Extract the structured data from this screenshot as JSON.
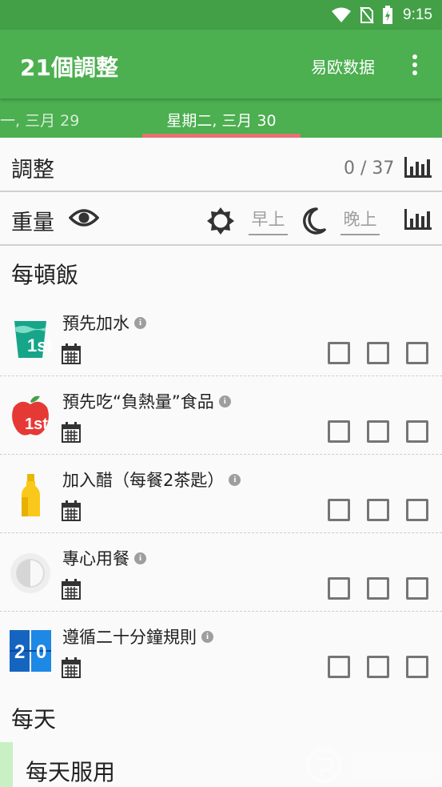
{
  "status_bar": {
    "time": "9:15"
  },
  "app_bar": {
    "title": "21個調整",
    "action": "易欧数据"
  },
  "tabs": {
    "previous": "一, 三月 29",
    "current": "星期二, 三月 30"
  },
  "adjustments": {
    "label": "調整",
    "count": "0 / 37"
  },
  "weight": {
    "label": "重量",
    "morning_placeholder": "早上",
    "evening_placeholder": "晚上"
  },
  "sections": {
    "every_meal": "每頓飯",
    "every_day": "每天",
    "daily_dose": "每天服用"
  },
  "habits": [
    {
      "label": "預先加水",
      "icon": "water-glass-icon",
      "badge": "1st"
    },
    {
      "label": "預先吃“負熱量”食品",
      "icon": "apple-icon",
      "badge": "1st"
    },
    {
      "label": "加入醋（每餐2茶匙）",
      "icon": "vinegar-bottle-icon"
    },
    {
      "label": "專心用餐",
      "icon": "mindful-plate-icon"
    },
    {
      "label": "遵循二十分鐘規則",
      "icon": "twenty-minute-icon",
      "digits": [
        "2",
        "0"
      ]
    }
  ],
  "colors": {
    "primary": "#4caf50",
    "status": "#43a047",
    "tab_indicator": "#e57373",
    "daily_accent": "#c8f0c4"
  }
}
